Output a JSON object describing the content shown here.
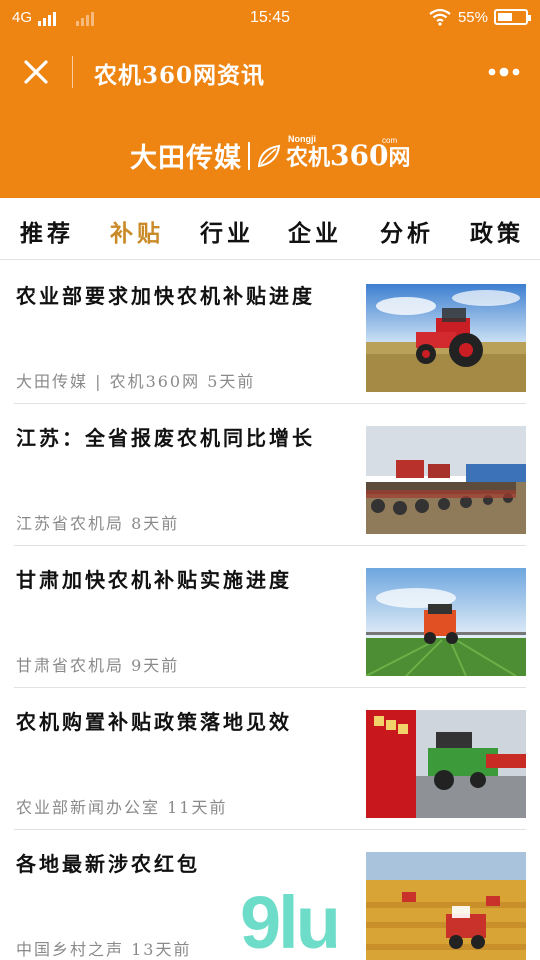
{
  "status_bar": {
    "network": "4G",
    "time": "15:45",
    "battery": "55%",
    "battery_level": 0.55
  },
  "nav": {
    "title": "农机360网资讯"
  },
  "brand": {
    "name": "大田传媒",
    "site_pinyin": "Nongji",
    "site_cn": "农机",
    "site_num": "360",
    "site_suffix": "网",
    "site_com": "com"
  },
  "tabs": [
    {
      "label": "推荐",
      "active": false
    },
    {
      "label": "补贴",
      "active": true
    },
    {
      "label": "行业",
      "active": false
    },
    {
      "label": "企业",
      "active": false
    },
    {
      "label": "分析",
      "active": false
    },
    {
      "label": "政策",
      "active": false
    }
  ],
  "news": [
    {
      "title": "农业部要求加快农机补贴进度",
      "meta": "大田传媒 | 农机360网  5天前",
      "thumb": "red-tractor-image"
    },
    {
      "title": "江苏：全省报废农机同比增长",
      "meta": "江苏省农机局  8天前",
      "thumb": "scrapped-machinery-image"
    },
    {
      "title": "甘肃加快农机补贴实施进度",
      "meta": "甘肃省农机局  9天前",
      "thumb": "sprayer-tractor-image"
    },
    {
      "title": "农机购置补贴政策落地见效",
      "meta": "农业部新闻办公室  11天前",
      "thumb": "green-harvester-image"
    },
    {
      "title": "各地最新涉农红包",
      "meta": "中国乡村之声  13天前",
      "thumb": "wheat-harvest-image"
    }
  ],
  "watermark": "9lu"
}
